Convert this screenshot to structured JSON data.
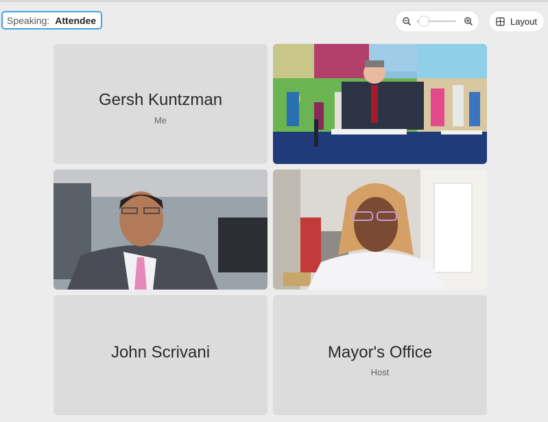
{
  "speaking": {
    "label": "Speaking:",
    "name": "Attendee"
  },
  "toolbar": {
    "zoom_level": 0.08,
    "layout_label": "Layout"
  },
  "participants": [
    {
      "name": "Gersh Kuntzman",
      "subtitle": "Me",
      "video": false
    },
    {
      "name": "",
      "subtitle": "",
      "video": true
    },
    {
      "name": "",
      "subtitle": "",
      "video": true
    },
    {
      "name": "",
      "subtitle": "",
      "video": true
    },
    {
      "name": "John Scrivani",
      "subtitle": "",
      "video": false
    },
    {
      "name": "Mayor's Office",
      "subtitle": "Host",
      "video": false
    }
  ],
  "colors": {
    "accent": "#3aa3e3",
    "tile_bg": "#dcdcdc",
    "page_bg": "#ececec"
  }
}
